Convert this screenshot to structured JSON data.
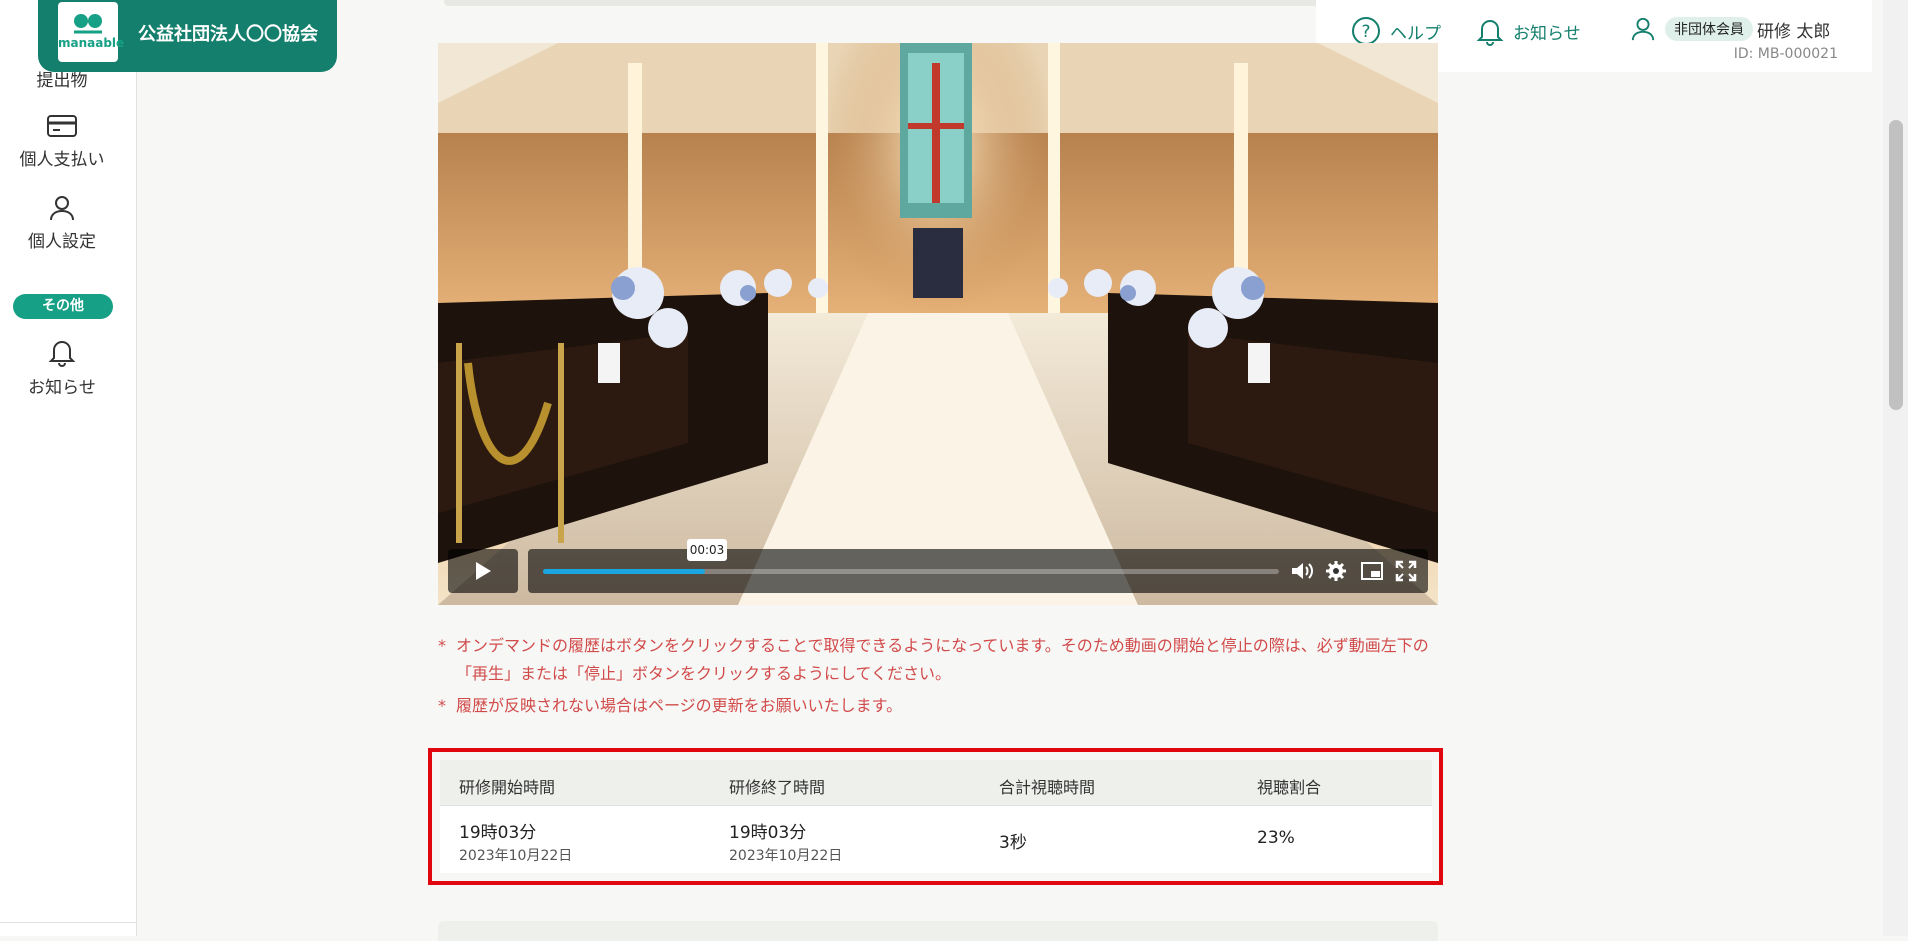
{
  "org": {
    "logo_text": "manaable",
    "name": "公益社団法人〇〇協会"
  },
  "sidebar": {
    "items": [
      {
        "label": "提出物"
      },
      {
        "label": "個人支払い"
      },
      {
        "label": "個人設定"
      },
      {
        "label": "お知らせ"
      }
    ],
    "section_label": "その他"
  },
  "header": {
    "help": "ヘルプ",
    "notice": "お知らせ",
    "badge": "非団体会員",
    "user_name": "研修 太郎",
    "user_id": "ID: MB-000021"
  },
  "video": {
    "current_time": "00:03",
    "progress": 0.22
  },
  "notes": [
    {
      "mark": "*",
      "text": "オンデマンドの履歴はボタンをクリックすることで取得できるようになっています。そのため動画の開始と停止の際は、必ず動画左下の「再生」または「停止」ボタンをクリックするようにしてください。"
    },
    {
      "mark": "*",
      "text": "履歴が反映されない場合はページの更新をお願いいたします。"
    }
  ],
  "history_table": {
    "headers": [
      "研修開始時間",
      "研修終了時間",
      "合計視聴時間",
      "視聴割合"
    ],
    "row": {
      "start_time": "19時03分",
      "start_date": "2023年10月22日",
      "end_time": "19時03分",
      "end_date": "2023年10月22日",
      "total": "3秒",
      "ratio": "23%"
    }
  }
}
